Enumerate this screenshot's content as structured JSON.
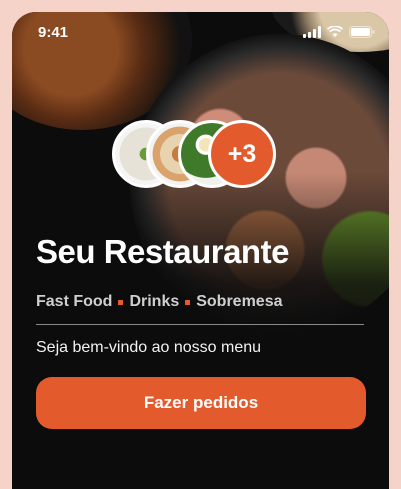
{
  "status_bar": {
    "time": "9:41"
  },
  "gallery": {
    "more_count": "+3"
  },
  "restaurant": {
    "name": "Seu Restaurante",
    "categories": [
      "Fast Food",
      "Drinks",
      "Sobremesa"
    ],
    "welcome": "Seja bem-vindo ao nosso menu"
  },
  "actions": {
    "order_label": "Fazer pedidos"
  },
  "colors": {
    "accent": "#e35b2d",
    "background": "#0c0c0c",
    "frame": "#f6d3c8"
  }
}
